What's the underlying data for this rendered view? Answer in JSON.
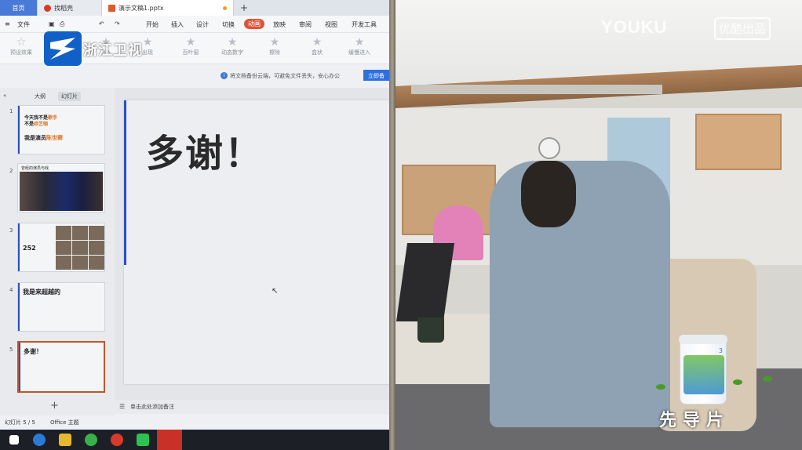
{
  "tabs": {
    "home": "首页",
    "wps": "找稻壳",
    "doc": "演示文稿1.pptx",
    "new": "+"
  },
  "menu": {
    "file": "文件",
    "items": [
      "开始",
      "插入",
      "设计",
      "切换",
      "动画",
      "放映",
      "审阅",
      "视图",
      "开发工具"
    ],
    "active": "动画"
  },
  "ribbon": {
    "items": [
      "预设效果",
      "飞入",
      "出现",
      "百叶窗",
      "动态数字",
      "擦除",
      "盒状",
      "缓慢进入"
    ]
  },
  "logo": {
    "text": "浙江卫视"
  },
  "notice": {
    "text": "将文档备份云端，可避免文件丢失，安心办公",
    "button": "立即备"
  },
  "panel": {
    "collapse": "«",
    "tab1": "大纲",
    "tab2": "幻灯片"
  },
  "slides": [
    {
      "num": "1",
      "l1a": "今天我不是",
      "l1b": "歌手",
      "l2a": "不是",
      "l2b": "综艺咖",
      "l3a": "我是演员",
      "l3b": "陈世藓"
    },
    {
      "num": "2",
      "title": "曾经的演员与戏"
    },
    {
      "num": "3",
      "text": "252"
    },
    {
      "num": "4",
      "text": "我是来超越的"
    },
    {
      "num": "5",
      "text": "多谢！"
    }
  ],
  "add_slide": "+",
  "main_slide": {
    "text": "多谢！"
  },
  "notes": {
    "icon": "☰",
    "text": "单击此处添加备注"
  },
  "status": {
    "slide": "幻灯片 5 / 5",
    "theme": "Office 主题"
  },
  "right": {
    "watermark": "YOUKU",
    "watermark_cn": "优酷出品",
    "caption": "先导片",
    "milk_num": "3"
  },
  "colors": {
    "accent": "#e0533b",
    "blue": "#2a4fc0",
    "youku": "#ffffff"
  }
}
